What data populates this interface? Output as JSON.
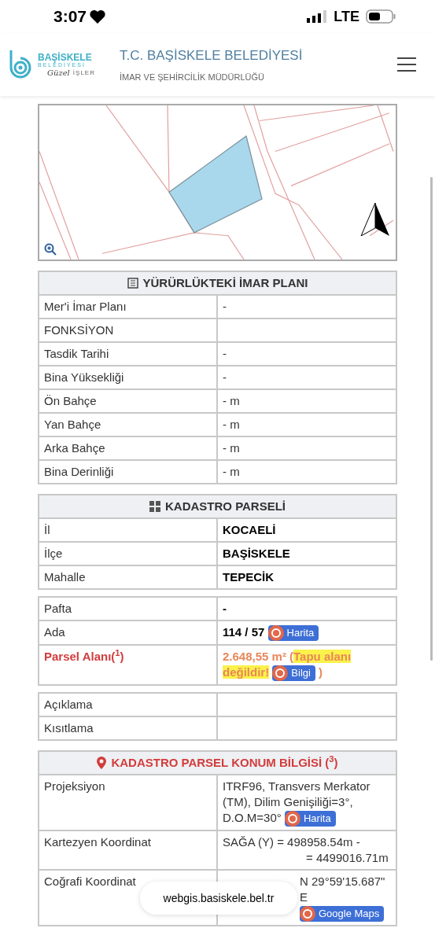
{
  "status_bar": {
    "time": "3:07",
    "network": "LTE"
  },
  "header": {
    "logo_name": "BAŞİSKELE",
    "logo_sub": "BELEDİYESİ",
    "logo_script": "Güzel",
    "logo_tagline": "İŞLER",
    "title": "T.C. BAŞİSKELE BELEDİYESİ",
    "subtitle": "İMAR VE ŞEHİRCİLİK MÜDÜRLÜĞÜ"
  },
  "sections": [
    {
      "title": "YÜRÜRLÜKTEKİ İMAR PLANI",
      "kind": "list",
      "groups": [
        [
          {
            "label": "Mer'i İmar Planı",
            "value": "-"
          },
          {
            "label": "FONKSİYON"
          },
          {
            "label": "Tasdik Tarihi",
            "value": "-"
          },
          {
            "label": "Bina Yüksekliği",
            "value": "-"
          },
          {
            "label": "Ön Bahçe",
            "value": "- m"
          },
          {
            "label": "Yan Bahçe",
            "value": "- m"
          },
          {
            "label": "Arka Bahçe",
            "value": "- m"
          },
          {
            "label": "Bina Derinliği",
            "value": "- m"
          }
        ]
      ]
    },
    {
      "title": "KADASTRO PARSELİ",
      "kind": "grid",
      "groups": [
        [
          {
            "label": "İl",
            "value": "KOCAELİ",
            "bold": true
          },
          {
            "label": "İlçe",
            "value": "BAŞİSKELE",
            "bold": true
          },
          {
            "label": "Mahalle",
            "value": "TEPECİK",
            "bold": true
          }
        ],
        [
          {
            "label": "Pafta",
            "value": "-",
            "bold": true
          },
          {
            "label": "Ada",
            "value": "114 / 57",
            "bold": true,
            "button": "Harita"
          },
          {
            "label": "Parsel Alanı($^{1}$)",
            "alert": true,
            "value": "2.648,55 m² (",
            "highlight": "Tapu alanı değildir!",
            "button": "Bilgi",
            "suffix": ")"
          }
        ],
        [
          {
            "label": "Açıklama"
          },
          {
            "label": "Kısıtlama"
          }
        ]
      ]
    },
    {
      "title": "KADASTRO PARSEL KONUM BİLGİSİ ($^{3}$)",
      "kind": "location",
      "groups": [
        [
          {
            "label": "Projeksiyon",
            "value": "ITRF96, Transvers Merkator (TM), Dilim Genişiliği=3°,",
            "line2": "D.O.M=30°",
            "button": "Harita"
          },
          {
            "label": "Kartezyen Koordinat",
            "value": "SAĞA (Y) = 498958.54m -",
            "line2": "= 4499016.71m"
          },
          {
            "label": "Coğrafi Koordinat",
            "value": "N 29°59'15.687\" E",
            "button": "Google Maps",
            "indent": true
          }
        ]
      ]
    }
  ],
  "url_bar": {
    "url": "webgis.basiskele.bel.tr"
  }
}
